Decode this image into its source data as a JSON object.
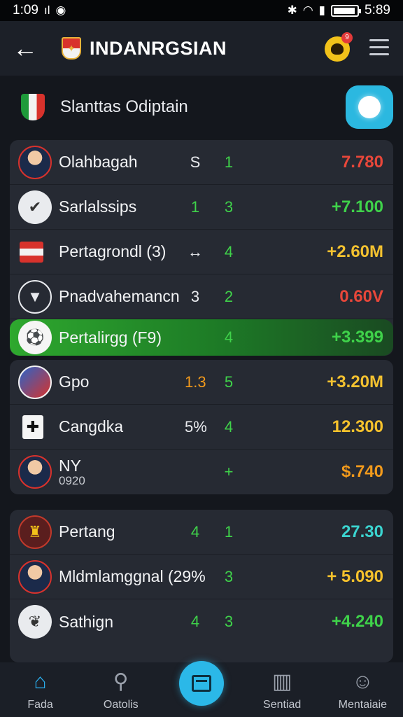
{
  "status_bar": {
    "time_left": "1:09",
    "signal_text": "ıl",
    "time_right": "5:89"
  },
  "app_bar": {
    "title": "INDANRGSIAN",
    "notification_count": "9"
  },
  "section": {
    "title": "Slanttas Odiptain"
  },
  "card1": [
    {
      "name": "Olahbagah",
      "c1": "S",
      "c1_color": "white",
      "c2": "1",
      "value": "7.780",
      "value_color": "red",
      "avatar": "person"
    },
    {
      "name": "Sarlalssips",
      "c1": "1",
      "c1_color": "green",
      "c2": "3",
      "value": "+7.100",
      "value_color": "green",
      "avatar": "check"
    },
    {
      "name": "Pertagrondl (3)",
      "c1": "↔",
      "c1_color": "white",
      "c2": "4",
      "value": "+2.60M",
      "value_color": "yellow",
      "avatar": "flag"
    },
    {
      "name": "Pnadvahemancn",
      "c1": "3",
      "c1_color": "white",
      "c2": "2",
      "value": "0.60V",
      "value_color": "red",
      "avatar": "shield"
    },
    {
      "name": "Pertalirgg (F9)",
      "c1": "",
      "c1_color": "white",
      "c2": "4",
      "value": "+3.399",
      "value_color": "green",
      "avatar": "ball",
      "highlight": true
    }
  ],
  "card2": [
    {
      "name": "Gpo",
      "c1": "1.3",
      "c1_color": "orange",
      "c2": "5",
      "value": "+3.20M",
      "value_color": "yellow",
      "avatar": "crest"
    },
    {
      "name": "Cangdka",
      "c1": "5%",
      "c1_color": "white",
      "c2": "4",
      "value": "12.300",
      "value_color": "gold",
      "avatar": "cross"
    },
    {
      "name": "NY",
      "sub": "0920",
      "c1": "",
      "c1_color": "white",
      "c2": "+",
      "value": "$.740",
      "value_color": "orange",
      "avatar": "person"
    }
  ],
  "card3": [
    {
      "name": "Pertang",
      "c1": "4",
      "c1_color": "green",
      "c2": "1",
      "value": "27.30",
      "value_color": "cyan",
      "avatar": "badge"
    },
    {
      "name": "Mldmlamggnal (29%",
      "c1": "",
      "c1_color": "white",
      "c2": "3",
      "value": "+ 5.090",
      "value_color": "gold",
      "avatar": "person"
    },
    {
      "name": "Sathign",
      "c1": "4",
      "c1_color": "green",
      "c2": "3",
      "value": "+4.240",
      "value_color": "green",
      "avatar": "wing"
    }
  ],
  "bottom_nav": [
    {
      "label": "Fada",
      "icon": "home-icon",
      "active": true
    },
    {
      "label": "Oatolis",
      "icon": "search-icon"
    },
    {
      "label": "",
      "icon": "center-icon",
      "center": true
    },
    {
      "label": "Sentiad",
      "icon": "chart-icon"
    },
    {
      "label": "Mentaiaie",
      "icon": "user-icon"
    }
  ]
}
